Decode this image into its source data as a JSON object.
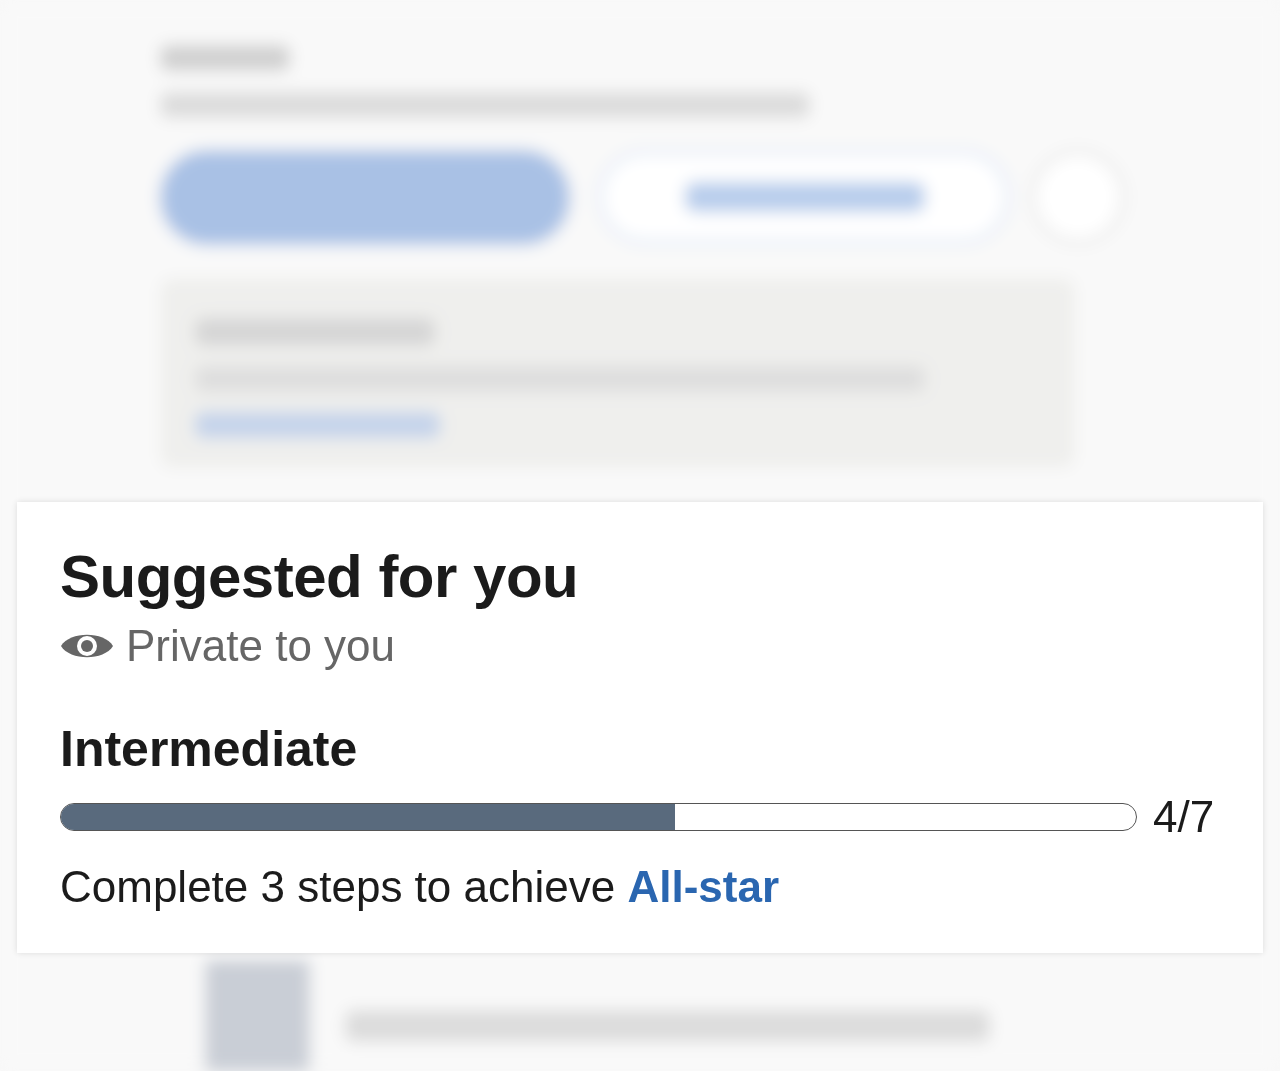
{
  "card": {
    "title": "Suggested for you",
    "visibility": "Private to you",
    "level_name": "Intermediate",
    "progress": {
      "level": 0.5714,
      "reading": "4/7"
    },
    "hint": {
      "text": "Complete 3 steps to achieve",
      "link": "All-star"
    }
  }
}
